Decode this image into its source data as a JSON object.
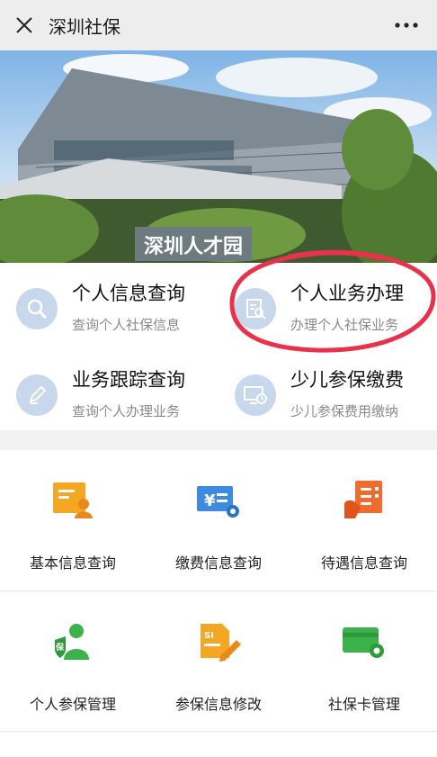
{
  "header": {
    "title": "深圳社保"
  },
  "banner": {
    "sign_text": "深圳人才园"
  },
  "quick_services": [
    {
      "title": "个人信息查询",
      "subtitle": "查询个人社保信息",
      "icon": "search-icon"
    },
    {
      "title": "个人业务办理",
      "subtitle": "办理个人社保业务",
      "icon": "document-search-icon"
    },
    {
      "title": "业务跟踪查询",
      "subtitle": "查询个人办理业务",
      "icon": "pencil-icon"
    },
    {
      "title": "少儿参保缴费",
      "subtitle": "少儿参保费用缴纳",
      "icon": "monitor-clock-icon"
    }
  ],
  "grid_services": [
    {
      "label": "基本信息查询",
      "icon": "user-card-icon"
    },
    {
      "label": "缴费信息查询",
      "icon": "yuan-ticket-icon"
    },
    {
      "label": "待遇信息查询",
      "icon": "hand-list-icon"
    },
    {
      "label": "个人参保管理",
      "icon": "insured-person-icon"
    },
    {
      "label": "参保信息修改",
      "icon": "edit-document-icon"
    },
    {
      "label": "社保卡管理",
      "icon": "card-gear-icon"
    }
  ],
  "colors": {
    "accent_orange": "#f5a623",
    "accent_blue": "#3d8be0",
    "accent_green": "#3cb24a",
    "highlight_red": "#e8314a"
  }
}
